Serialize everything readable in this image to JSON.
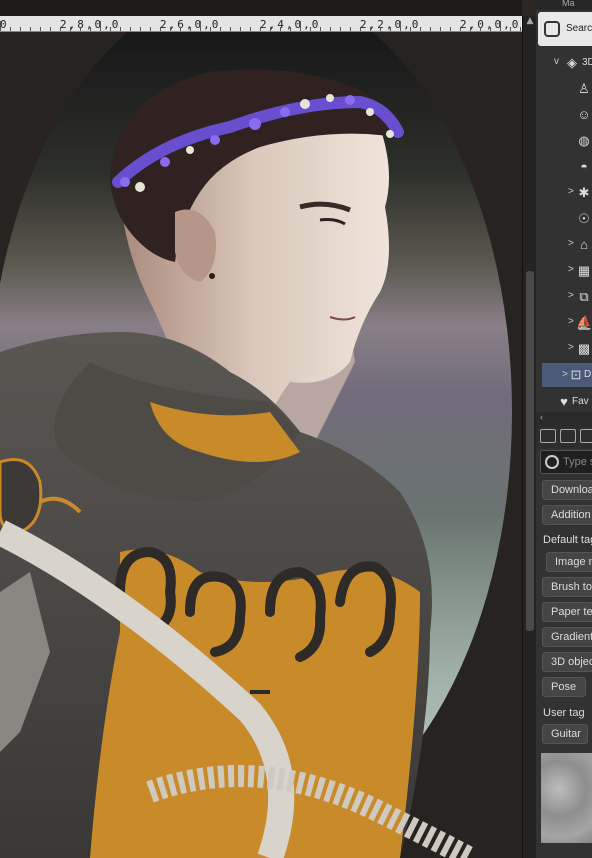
{
  "ruler": {
    "labels": [
      "0",
      "2,8,0,0",
      "2,6,0,0",
      "2,4,0,0",
      "2,2,0,0",
      "2,0,0,0"
    ]
  },
  "panel": {
    "title_fragment": "Ma",
    "search_tab": "Search",
    "tree": [
      {
        "label": "3D",
        "icon": "cube-icon",
        "chevron": "v"
      },
      {
        "label": "",
        "icon": "figure-pair-icon",
        "chevron": ""
      },
      {
        "label": "",
        "icon": "head-icon",
        "chevron": ""
      },
      {
        "label": "",
        "icon": "globe-icon",
        "chevron": ""
      },
      {
        "label": "",
        "icon": "cap-icon",
        "chevron": ""
      },
      {
        "label": "",
        "icon": "person-icon",
        "chevron": ">"
      },
      {
        "label": "",
        "icon": "people-icon",
        "chevron": ""
      },
      {
        "label": "",
        "icon": "bag-icon",
        "chevron": ">"
      },
      {
        "label": "",
        "icon": "building-icon",
        "chevron": ">"
      },
      {
        "label": "",
        "icon": "box-list-icon",
        "chevron": ">"
      },
      {
        "label": "",
        "icon": "ship-icon",
        "chevron": ">"
      },
      {
        "label": "",
        "icon": "grid-icon",
        "chevron": ">"
      },
      {
        "label": "D",
        "icon": "download-icon",
        "chevron": ">"
      }
    ],
    "favorites": "Fav",
    "filter_placeholder": "Type s",
    "tags_top": [
      "Downloa",
      "Addition"
    ],
    "default_tags_label": "Default tag",
    "default_tags": [
      "Image m",
      "Brush too",
      "Paper tex",
      "Gradient",
      "3D objec",
      "Pose"
    ],
    "user_tag_label": "User tag",
    "user_tags": [
      "Guitar"
    ]
  },
  "colors": {
    "panel_bg": "#323232",
    "selected_row": "#4c5a7a",
    "ruler_bg": "#e4e4e4",
    "canvas_bg": "#262320"
  }
}
